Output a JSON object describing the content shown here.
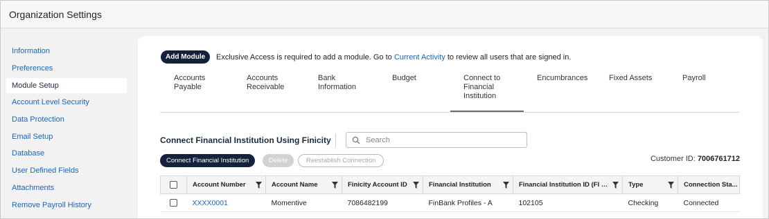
{
  "window": {
    "title": "Organization Settings"
  },
  "sidebar": {
    "items": [
      {
        "label": "Information",
        "active": false
      },
      {
        "label": "Preferences",
        "active": false
      },
      {
        "label": "Module Setup",
        "active": true
      },
      {
        "label": "Account Level Security",
        "active": false
      },
      {
        "label": "Data Protection",
        "active": false
      },
      {
        "label": "Email Setup",
        "active": false
      },
      {
        "label": "Database",
        "active": false
      },
      {
        "label": "User Defined Fields",
        "active": false
      },
      {
        "label": "Attachments",
        "active": false
      },
      {
        "label": "Remove Payroll History",
        "active": false
      }
    ]
  },
  "module_bar": {
    "add_module_label": "Add Module",
    "message_prefix": "Exclusive Access is required to add a module. Go to ",
    "message_link": "Current Activity",
    "message_suffix": " to review all users that are signed in."
  },
  "tabs": [
    {
      "line1": "Accounts",
      "line2": "Payable",
      "line3": ""
    },
    {
      "line1": "Accounts",
      "line2": "Receivable",
      "line3": ""
    },
    {
      "line1": "Bank",
      "line2": "Information",
      "line3": ""
    },
    {
      "line1": "Budget",
      "line2": "",
      "line3": ""
    },
    {
      "line1": "Connect to",
      "line2": "Financial",
      "line3": "Institution"
    },
    {
      "line1": "Encumbrances",
      "line2": "",
      "line3": ""
    },
    {
      "line1": "Fixed Assets",
      "line2": "",
      "line3": ""
    },
    {
      "line1": "Payroll",
      "line2": "",
      "line3": ""
    }
  ],
  "active_tab": "Connect to Financial Institution",
  "section": {
    "title": "Connect Financial Institution Using Finicity",
    "search_placeholder": "Search",
    "search_value": ""
  },
  "actions": {
    "connect_label": "Connect Financial Institution",
    "delete_label": "Delete",
    "reestablish_label": "Reestablish Connection"
  },
  "customer": {
    "label": "Customer ID:",
    "value": "7006761712"
  },
  "table": {
    "columns": [
      "Account Number",
      "Account Name",
      "Finicity Account ID",
      "Financial Institution",
      "Financial Institution ID (FI ID)",
      "Type",
      "Connection Sta..."
    ],
    "rows": [
      {
        "account_number": "XXXX0001",
        "account_name": "Momentive",
        "finicity_account_id": "7086482199",
        "financial_institution": "FinBank Profiles - A",
        "fi_id": "102105",
        "type": "Checking",
        "connection_status": "Connected"
      }
    ]
  },
  "colors": {
    "primary_button": "#14213d",
    "link": "#1a64b5",
    "panel": "#ffffff",
    "background": "#f2f2f2"
  },
  "icons": {
    "search": "search-icon",
    "filter": "filter-icon"
  }
}
